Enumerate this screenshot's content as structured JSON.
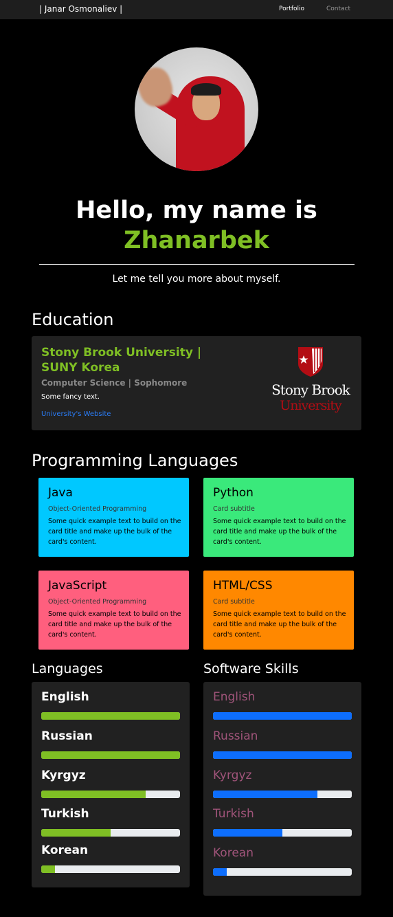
{
  "nav": {
    "brand": "| Janar Osmonaliev |",
    "links": [
      {
        "label": "Portfolio"
      },
      {
        "label": "Contact"
      }
    ]
  },
  "hero": {
    "greeting": "Hello, my name is",
    "name": "Zhanarbek",
    "tagline": "Let me tell you more about myself."
  },
  "colors": {
    "accent": "#7fbf24",
    "link": "#2a7cf6",
    "soft_bar": "#0d6efd"
  },
  "education": {
    "heading": "Education",
    "school": "Stony Brook University | SUNY Korea",
    "major": "Computer Science | Sophomore",
    "text": "Some fancy text.",
    "link": "University's Website",
    "logo_line1": "Stony Brook",
    "logo_line2": "University"
  },
  "programming": {
    "heading": "Programming Languages",
    "cards": [
      {
        "title": "Java",
        "subtitle": "Object-Oriented Programming",
        "text": "Some quick example text to build on the card title and make up the bulk of the card's content.",
        "color": "#00c8ff"
      },
      {
        "title": "Python",
        "subtitle": "Card subtitle",
        "text": "Some quick example text to build on the card title and make up the bulk of the card's content.",
        "color": "#3ae97b"
      },
      {
        "title": "JavaScript",
        "subtitle": "Object-Oriented Programming",
        "text": "Some quick example text to build on the card title and make up the bulk of the card's content.",
        "color": "#ff5f7e"
      },
      {
        "title": "HTML/CSS",
        "subtitle": "Card subtitle",
        "text": "Some quick example text to build on the card title and make up the bulk of the card's content.",
        "color": "#ff8800"
      }
    ]
  },
  "languages": {
    "heading": "Languages",
    "items": [
      {
        "name": "English",
        "level": 100
      },
      {
        "name": "Russian",
        "level": 100
      },
      {
        "name": "Kyrgyz",
        "level": 75
      },
      {
        "name": "Turkish",
        "level": 50
      },
      {
        "name": "Korean",
        "level": 10
      }
    ]
  },
  "software": {
    "heading": "Software Skills",
    "items": [
      {
        "name": "English",
        "level": 100
      },
      {
        "name": "Russian",
        "level": 100
      },
      {
        "name": "Kyrgyz",
        "level": 75
      },
      {
        "name": "Turkish",
        "level": 50
      },
      {
        "name": "Korean",
        "level": 10
      }
    ]
  }
}
